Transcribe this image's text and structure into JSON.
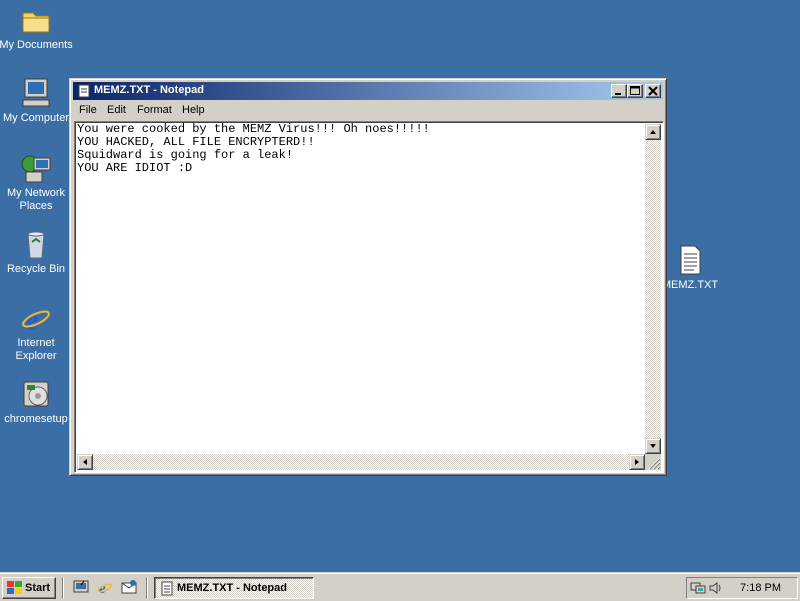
{
  "desktop": {
    "icons": [
      {
        "label": "My Documents",
        "icon": "folder-icon"
      },
      {
        "label": "My Computer",
        "icon": "computer-icon"
      },
      {
        "label": "My Network Places",
        "icon": "network-icon"
      },
      {
        "label": "Recycle Bin",
        "icon": "recycle-bin-icon"
      },
      {
        "label": "Internet Explorer",
        "icon": "internet-explorer-icon"
      },
      {
        "label": "chromesetup",
        "icon": "installer-icon"
      },
      {
        "label": "MEMZ.TXT",
        "icon": "text-file-icon"
      }
    ],
    "background_color": "#3a6ea5"
  },
  "window": {
    "title": "MEMZ.TXT - Notepad",
    "menu": [
      "File",
      "Edit",
      "Format",
      "Help"
    ],
    "content": "You were cooked by the MEMZ Virus!!! Oh noes!!!!!\nYOU HACKED, ALL FILE ENCRYPTERD!!\nSquidward is going for a leak!\nYOU ARE IDIOT :D"
  },
  "taskbar": {
    "start_label": "Start",
    "task_label": "MEMZ.TXT - Notepad",
    "clock": "7:18 PM"
  }
}
